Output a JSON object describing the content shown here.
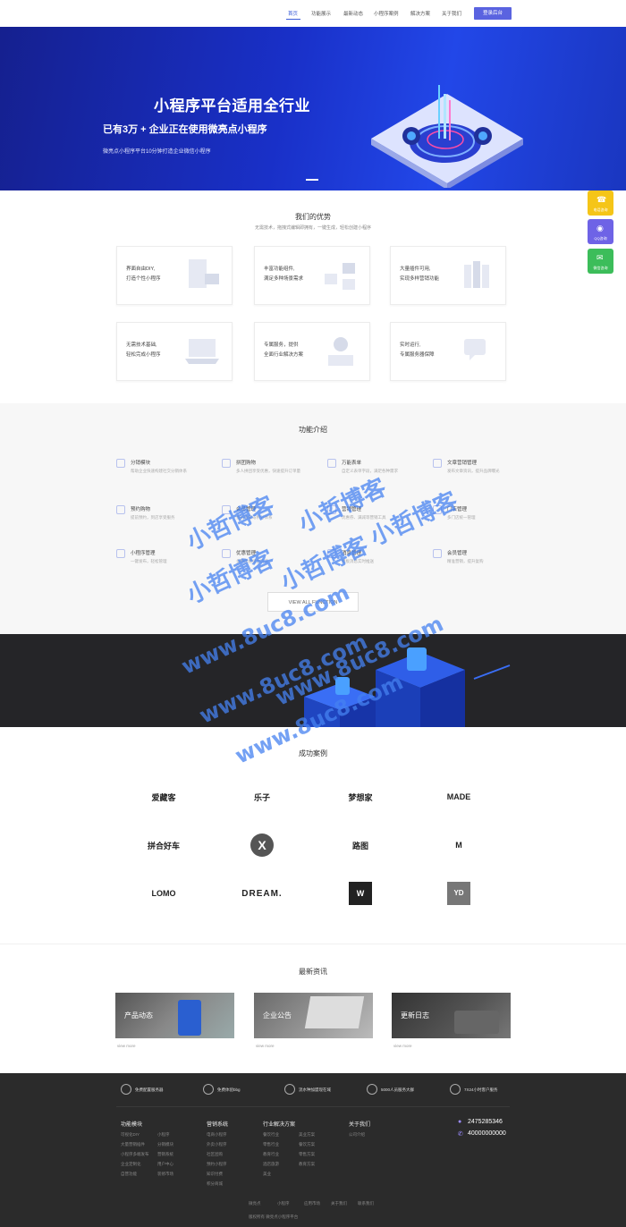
{
  "nav": {
    "items": [
      "首页",
      "功能展示",
      "最新动态",
      "小程序案例",
      "解决方案",
      "关于我们"
    ],
    "login": "登录后台"
  },
  "hero": {
    "title": "小程序平台适用全行业",
    "subtitle": "已有3万 + 企业正在使用微亮点小程序",
    "desc": "微亮点小程序平台10分钟打造企业微信小程序"
  },
  "advantages": {
    "title": "我们的优势",
    "subtitle": "无需技术，拖拽式编辑即拥有，一键生成，轻松创建小程序",
    "cards": [
      {
        "line1": "界面自由DIY,",
        "line2": "打造个性小程序"
      },
      {
        "line1": "丰富功能组件,",
        "line2": "满足多种场景需求"
      },
      {
        "line1": "大量插件可用,",
        "line2": "实现多样营销功能"
      },
      {
        "line1": "无需技术基础,",
        "line2": "轻松完成小程序"
      },
      {
        "line1": "专属服务，提供",
        "line2": "全面行业解决方案"
      },
      {
        "line1": "实时运行,",
        "line2": "专属服务器保障"
      }
    ]
  },
  "features": {
    "title": "功能介绍",
    "items": [
      {
        "title": "分销模块",
        "desc": "帮助企业快速构建社交分销体系"
      },
      {
        "title": "拼团购物",
        "desc": "多人拼团享受优惠，快速提升订单量"
      },
      {
        "title": "万能表单",
        "desc": "自定义表单字段，满足各种需求"
      },
      {
        "title": "文章营销管理",
        "desc": "发布文章资讯，提升品牌曝光"
      },
      {
        "title": "预约购物",
        "desc": "提前预约，到店享受服务"
      },
      {
        "title": "会员管理",
        "desc": "会员等级与积分体系"
      },
      {
        "title": "营销管理",
        "desc": "优惠券、满减等营销工具"
      },
      {
        "title": "门店管理",
        "desc": "多门店统一管理"
      },
      {
        "title": "小程序管理",
        "desc": "一键发布，轻松管理"
      },
      {
        "title": "优惠管理",
        "desc": "多种优惠组合玩法"
      },
      {
        "title": "消息管理",
        "desc": "模板消息实时推送"
      },
      {
        "title": "会员管理",
        "desc": "精准营销，提升复购"
      }
    ],
    "view_all": "VIEW ALL FUNCTION"
  },
  "cases": {
    "title": "成功案例",
    "logos": [
      "爱藏客",
      "乐子",
      "梦想家",
      "MADE",
      "拼合好车",
      "X",
      "路图",
      "M",
      "LOMO",
      "DREAM.",
      "W",
      "YD"
    ]
  },
  "news": {
    "title": "最新资讯",
    "cards": [
      "产品动态",
      "企业公告",
      "更新日志"
    ],
    "more": "view more"
  },
  "footer": {
    "services": [
      "免费配置服务器",
      "免费体验bbg",
      "流水种加盟现在域",
      "5000人员服务大群",
      "7X24小时客户服务"
    ],
    "columns": [
      {
        "title": "功能模块",
        "links": [
          "可视化DIY",
          "大量营销插件",
          "小程序多端发布",
          "企业定制化",
          "自营功能"
        ]
      },
      {
        "title": "营销系统",
        "links": [
          "电商小程序",
          "外卖小程序",
          "社区团购",
          "预约小程序",
          "知识付费",
          "积分商城"
        ]
      },
      {
        "title": "行业解决方案",
        "links": [
          "餐饮行业",
          "零售行业",
          "教育行业",
          "酒店旅游",
          "美业"
        ]
      },
      {
        "title": "关于我们",
        "links": [
          "公司介绍"
        ]
      }
    ],
    "extra_links": [
      "小程序",
      "分销模块",
      "营销系统",
      "用户中心",
      "装修市场"
    ],
    "extra_links2": [
      "美业方案",
      "餐饮方案",
      "零售方案",
      "教育方案"
    ],
    "phone1": "2475285346",
    "phone2": "40000000000",
    "bottom_links": [
      "微亮点",
      "小程序",
      "应用市场",
      "关于我们",
      "联系我们"
    ],
    "copyright": "版权所有 微亮点小程序平台"
  },
  "sidebar": [
    "电话咨询",
    "QQ咨询",
    "微信咨询"
  ],
  "watermark": [
    "小哲博客",
    "小哲博客",
    "小哲博客",
    "小哲博客",
    "小哲博客",
    "www.8uc8.com",
    "www.8uc8.com",
    "www.8uc8.com",
    "www.8uc8.com"
  ],
  "colors": {
    "accent": "#3b5cd9",
    "hero": "#1a33c8",
    "dark": "#252528",
    "footer": "#2b2b2b"
  }
}
